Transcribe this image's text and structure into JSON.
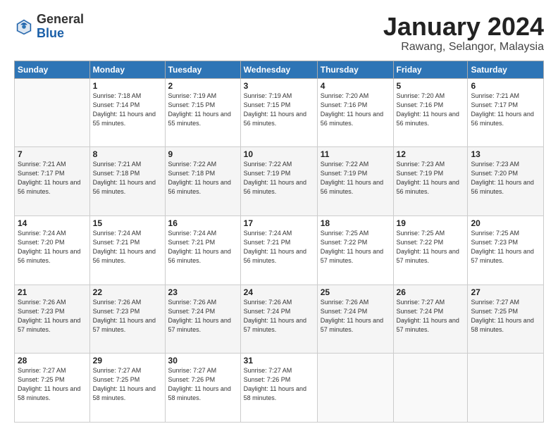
{
  "header": {
    "logo_general": "General",
    "logo_blue": "Blue",
    "month_title": "January 2024",
    "subtitle": "Rawang, Selangor, Malaysia"
  },
  "calendar": {
    "days_of_week": [
      "Sunday",
      "Monday",
      "Tuesday",
      "Wednesday",
      "Thursday",
      "Friday",
      "Saturday"
    ],
    "weeks": [
      [
        {
          "day": "",
          "info": ""
        },
        {
          "day": "1",
          "info": "Sunrise: 7:18 AM\nSunset: 7:14 PM\nDaylight: 11 hours\nand 55 minutes."
        },
        {
          "day": "2",
          "info": "Sunrise: 7:19 AM\nSunset: 7:15 PM\nDaylight: 11 hours\nand 55 minutes."
        },
        {
          "day": "3",
          "info": "Sunrise: 7:19 AM\nSunset: 7:15 PM\nDaylight: 11 hours\nand 56 minutes."
        },
        {
          "day": "4",
          "info": "Sunrise: 7:20 AM\nSunset: 7:16 PM\nDaylight: 11 hours\nand 56 minutes."
        },
        {
          "day": "5",
          "info": "Sunrise: 7:20 AM\nSunset: 7:16 PM\nDaylight: 11 hours\nand 56 minutes."
        },
        {
          "day": "6",
          "info": "Sunrise: 7:21 AM\nSunset: 7:17 PM\nDaylight: 11 hours\nand 56 minutes."
        }
      ],
      [
        {
          "day": "7",
          "info": "Sunrise: 7:21 AM\nSunset: 7:17 PM\nDaylight: 11 hours\nand 56 minutes."
        },
        {
          "day": "8",
          "info": "Sunrise: 7:21 AM\nSunset: 7:18 PM\nDaylight: 11 hours\nand 56 minutes."
        },
        {
          "day": "9",
          "info": "Sunrise: 7:22 AM\nSunset: 7:18 PM\nDaylight: 11 hours\nand 56 minutes."
        },
        {
          "day": "10",
          "info": "Sunrise: 7:22 AM\nSunset: 7:19 PM\nDaylight: 11 hours\nand 56 minutes."
        },
        {
          "day": "11",
          "info": "Sunrise: 7:22 AM\nSunset: 7:19 PM\nDaylight: 11 hours\nand 56 minutes."
        },
        {
          "day": "12",
          "info": "Sunrise: 7:23 AM\nSunset: 7:19 PM\nDaylight: 11 hours\nand 56 minutes."
        },
        {
          "day": "13",
          "info": "Sunrise: 7:23 AM\nSunset: 7:20 PM\nDaylight: 11 hours\nand 56 minutes."
        }
      ],
      [
        {
          "day": "14",
          "info": "Sunrise: 7:24 AM\nSunset: 7:20 PM\nDaylight: 11 hours\nand 56 minutes."
        },
        {
          "day": "15",
          "info": "Sunrise: 7:24 AM\nSunset: 7:21 PM\nDaylight: 11 hours\nand 56 minutes."
        },
        {
          "day": "16",
          "info": "Sunrise: 7:24 AM\nSunset: 7:21 PM\nDaylight: 11 hours\nand 56 minutes."
        },
        {
          "day": "17",
          "info": "Sunrise: 7:24 AM\nSunset: 7:21 PM\nDaylight: 11 hours\nand 56 minutes."
        },
        {
          "day": "18",
          "info": "Sunrise: 7:25 AM\nSunset: 7:22 PM\nDaylight: 11 hours\nand 57 minutes."
        },
        {
          "day": "19",
          "info": "Sunrise: 7:25 AM\nSunset: 7:22 PM\nDaylight: 11 hours\nand 57 minutes."
        },
        {
          "day": "20",
          "info": "Sunrise: 7:25 AM\nSunset: 7:23 PM\nDaylight: 11 hours\nand 57 minutes."
        }
      ],
      [
        {
          "day": "21",
          "info": "Sunrise: 7:26 AM\nSunset: 7:23 PM\nDaylight: 11 hours\nand 57 minutes."
        },
        {
          "day": "22",
          "info": "Sunrise: 7:26 AM\nSunset: 7:23 PM\nDaylight: 11 hours\nand 57 minutes."
        },
        {
          "day": "23",
          "info": "Sunrise: 7:26 AM\nSunset: 7:24 PM\nDaylight: 11 hours\nand 57 minutes."
        },
        {
          "day": "24",
          "info": "Sunrise: 7:26 AM\nSunset: 7:24 PM\nDaylight: 11 hours\nand 57 minutes."
        },
        {
          "day": "25",
          "info": "Sunrise: 7:26 AM\nSunset: 7:24 PM\nDaylight: 11 hours\nand 57 minutes."
        },
        {
          "day": "26",
          "info": "Sunrise: 7:27 AM\nSunset: 7:24 PM\nDaylight: 11 hours\nand 57 minutes."
        },
        {
          "day": "27",
          "info": "Sunrise: 7:27 AM\nSunset: 7:25 PM\nDaylight: 11 hours\nand 58 minutes."
        }
      ],
      [
        {
          "day": "28",
          "info": "Sunrise: 7:27 AM\nSunset: 7:25 PM\nDaylight: 11 hours\nand 58 minutes."
        },
        {
          "day": "29",
          "info": "Sunrise: 7:27 AM\nSunset: 7:25 PM\nDaylight: 11 hours\nand 58 minutes."
        },
        {
          "day": "30",
          "info": "Sunrise: 7:27 AM\nSunset: 7:26 PM\nDaylight: 11 hours\nand 58 minutes."
        },
        {
          "day": "31",
          "info": "Sunrise: 7:27 AM\nSunset: 7:26 PM\nDaylight: 11 hours\nand 58 minutes."
        },
        {
          "day": "",
          "info": ""
        },
        {
          "day": "",
          "info": ""
        },
        {
          "day": "",
          "info": ""
        }
      ]
    ]
  }
}
